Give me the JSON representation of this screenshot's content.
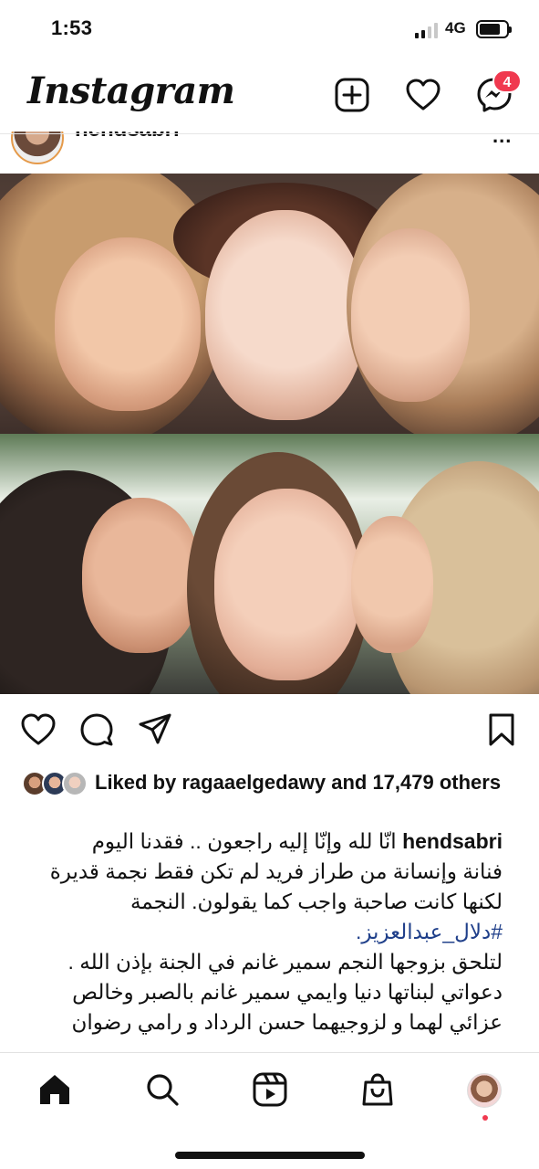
{
  "status_bar": {
    "time": "1:53",
    "network": "4G",
    "battery_level": 0.78
  },
  "header": {
    "logo": "Instagram",
    "notification_count": "4"
  },
  "post": {
    "username": "hendsabri",
    "more": "..."
  },
  "likes": {
    "text": "Liked by ragaaelgedawy and 17,479 others"
  },
  "caption": {
    "username": "hendsabri",
    "line1": "انّا لله وإنّا إليه راجعون .. فقدنا اليوم",
    "line2": "فنانة وإنسانة من طراز فريد لم تكن فقط نجمة قديرة",
    "line3": "لكنها كانت صاحبة واجب كما يقولون. النجمة",
    "hashtag": "#دلال_عبدالعزيز.",
    "line5": "لتلحق بزوجها النجم سمير غانم في الجنة بإذن الله .",
    "line6": "دعواتي لبناتها دنيا وايمي سمير غانم بالصبر وخالص",
    "line7": "عزائي لهما و لزوجيهما  حسن الرداد و رامي رضوان"
  },
  "icons": {
    "new_post": "plus-square-icon",
    "activity": "heart-icon",
    "messages": "messenger-icon",
    "like": "heart-icon",
    "comment": "comment-icon",
    "share": "send-icon",
    "save": "bookmark-icon",
    "home": "home-icon",
    "search": "search-icon",
    "reels": "reels-icon",
    "shop": "shop-icon"
  },
  "colors": {
    "badge": "#f0394f",
    "hashtag": "#1f3f8a"
  }
}
